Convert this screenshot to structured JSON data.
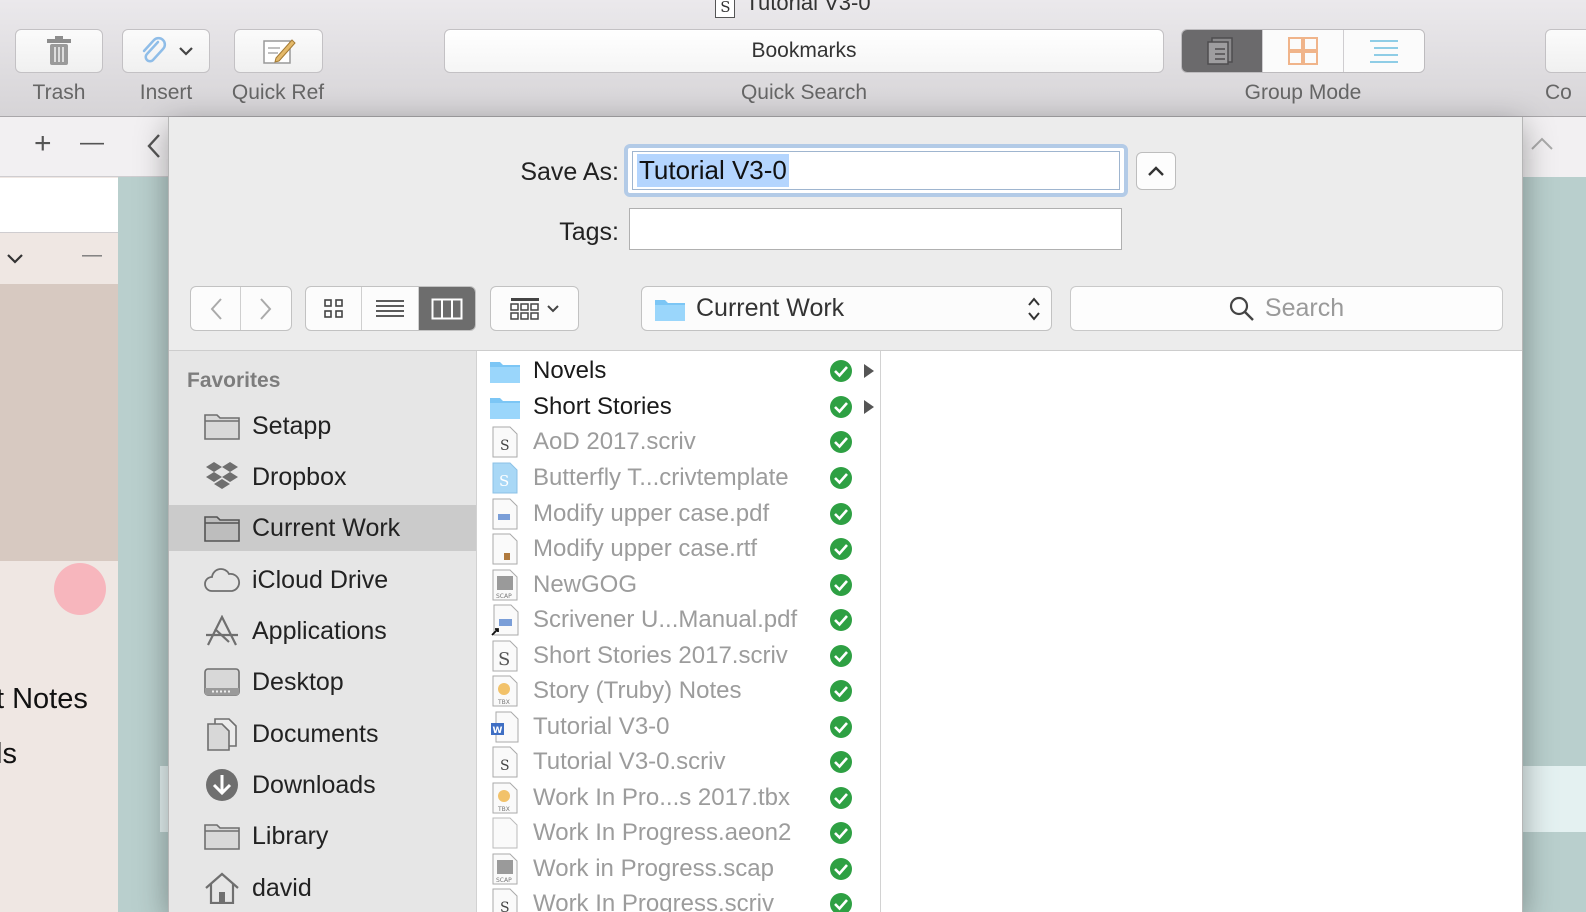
{
  "window": {
    "title": "Tutorial V3-0"
  },
  "toolbar": {
    "trash_label": "Trash",
    "insert_label": "Insert",
    "quickref_label": "Quick Ref",
    "bookmarks_label": "Bookmarks",
    "quicksearch_label": "Quick Search",
    "groupmode_label": "Group Mode",
    "cut_label": "Co"
  },
  "background": {
    "add_symbol": "+",
    "minus_symbol": "—",
    "minus2_symbol": "—",
    "back_chevron": "<",
    "collapse_chevron": "^",
    "dropdown_chevron": "v",
    "text1": "t Notes",
    "text2": "ls"
  },
  "dialog": {
    "save_as_label": "Save As:",
    "save_as_value": "Tutorial V3-0",
    "tags_label": "Tags:",
    "tags_value": "",
    "location": "Current Work",
    "search_placeholder": "Search"
  },
  "sidebar": {
    "heading": "Favorites",
    "items": [
      {
        "label": "Setapp",
        "icon": "folder-icon"
      },
      {
        "label": "Dropbox",
        "icon": "dropbox-icon"
      },
      {
        "label": "Current Work",
        "icon": "folder-icon",
        "selected": true
      },
      {
        "label": "iCloud Drive",
        "icon": "cloud-icon"
      },
      {
        "label": "Applications",
        "icon": "applications-icon"
      },
      {
        "label": "Desktop",
        "icon": "desktop-icon"
      },
      {
        "label": "Documents",
        "icon": "documents-icon"
      },
      {
        "label": "Downloads",
        "icon": "download-icon"
      },
      {
        "label": "Library",
        "icon": "folder-icon"
      },
      {
        "label": "david",
        "icon": "home-icon"
      }
    ]
  },
  "files": [
    {
      "name": "Novels",
      "kind": "folder",
      "synced": true,
      "has_children": true
    },
    {
      "name": "Short Stories",
      "kind": "folder",
      "synced": true,
      "has_children": true
    },
    {
      "name": "AoD 2017.scriv",
      "kind": "scriv",
      "synced": true
    },
    {
      "name": "Butterfly T...crivtemplate",
      "kind": "template",
      "synced": true
    },
    {
      "name": "Modify upper case.pdf",
      "kind": "pdf",
      "synced": true
    },
    {
      "name": "Modify upper case.rtf",
      "kind": "rtf",
      "synced": true
    },
    {
      "name": "NewGOG",
      "kind": "scap",
      "synced": true
    },
    {
      "name": "Scrivener U...Manual.pdf",
      "kind": "pdf-alias",
      "synced": true
    },
    {
      "name": "Short Stories 2017.scriv",
      "kind": "scriv",
      "synced": true
    },
    {
      "name": "Story (Truby) Notes",
      "kind": "tbx",
      "synced": true
    },
    {
      "name": "Tutorial V3-0",
      "kind": "word",
      "synced": true
    },
    {
      "name": "Tutorial V3-0.scriv",
      "kind": "scriv",
      "synced": true
    },
    {
      "name": "Work In Pro...s 2017.tbx",
      "kind": "tbx",
      "synced": true
    },
    {
      "name": "Work In Progress.aeon2",
      "kind": "blank",
      "synced": true
    },
    {
      "name": "Work in Progress.scap",
      "kind": "scap",
      "synced": true
    },
    {
      "name": "Work In Progress.scriv",
      "kind": "scriv",
      "synced": true
    }
  ],
  "colors": {
    "selection": "#b4d5fe",
    "focus_ring": "#b3cbe7",
    "sync_green": "#28a745",
    "folder_blue": "#7cc6f5",
    "background_teal": "#b9cfcd"
  }
}
